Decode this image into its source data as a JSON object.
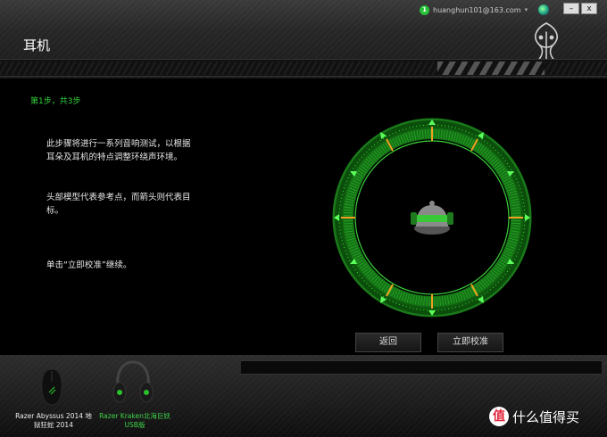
{
  "window": {
    "title": "耳机",
    "account": {
      "badge": "1",
      "email": "huanghun101@163.com",
      "caret": "▾"
    },
    "minimize": "–",
    "close": "x"
  },
  "main": {
    "step": "第1步，共3步",
    "desc1": "此步骤将进行一系列音响测试，以根据耳朵及耳机的特点调整环绕声环境。",
    "desc2": "头部模型代表参考点，而箭头则代表目标。",
    "desc3": "单击“立即校准”继续。",
    "back_label": "返回",
    "calibrate_label": "立即校准"
  },
  "devices": [
    {
      "name": "Razer Abyssus 2014 地狱狂蛇 2014"
    },
    {
      "name": "Razer Kraken北海巨妖USB版"
    }
  ],
  "watermark": {
    "badge": "值",
    "text": "什么值得买"
  },
  "colors": {
    "accent": "#34d33b",
    "orange": "#f0a020"
  }
}
